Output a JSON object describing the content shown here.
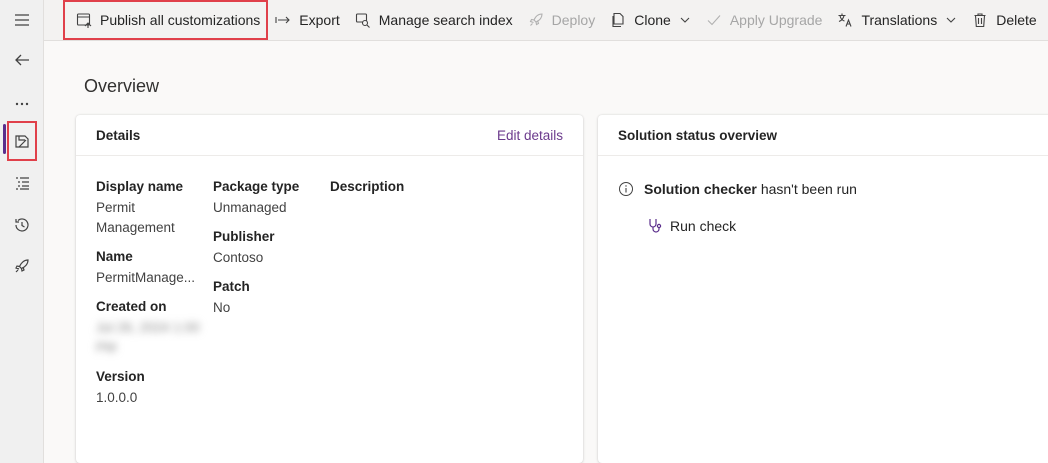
{
  "commandbar": {
    "items": [
      {
        "label": "Publish all customizations",
        "icon": "publish-icon",
        "enabled": true
      },
      {
        "label": "Export",
        "icon": "export-arrow-icon",
        "enabled": true
      },
      {
        "label": "Manage search index",
        "icon": "search-index-icon",
        "enabled": true
      },
      {
        "label": "Deploy",
        "icon": "rocket-icon",
        "enabled": false
      },
      {
        "label": "Clone",
        "icon": "clone-icon",
        "enabled": true,
        "dropdown": true
      },
      {
        "label": "Apply Upgrade",
        "icon": "checkmark-icon",
        "enabled": false
      },
      {
        "label": "Translations",
        "icon": "translate-icon",
        "enabled": true,
        "dropdown": true
      },
      {
        "label": "Delete",
        "icon": "trash-icon",
        "enabled": true
      }
    ]
  },
  "rail": {
    "items": [
      "hamburger-icon",
      "back-arrow-icon",
      "more-icon",
      "solution-icon",
      "objects-list-icon",
      "history-icon",
      "pipelines-rocket-icon"
    ]
  },
  "main": {
    "title": "Overview"
  },
  "details": {
    "header": "Details",
    "edit_link": "Edit details",
    "display_name_label": "Display name",
    "display_name_value": "Permit Management",
    "name_label": "Name",
    "name_value": "PermitManage...",
    "created_on_label": "Created on",
    "created_on_value": "Jul 26, 2024 1:00 PM",
    "version_label": "Version",
    "version_value": "1.0.0.0",
    "package_type_label": "Package type",
    "package_type_value": "Unmanaged",
    "publisher_label": "Publisher",
    "publisher_value": "Contoso",
    "patch_label": "Patch",
    "patch_value": "No",
    "description_label": "Description"
  },
  "status": {
    "header": "Solution status overview",
    "checker_name": "Solution checker",
    "checker_text": "hasn't been run",
    "run_check": "Run check"
  },
  "colors": {
    "accent": "#5b2e8c",
    "link": "#6b3a8c",
    "highlight": "#e0404a"
  }
}
